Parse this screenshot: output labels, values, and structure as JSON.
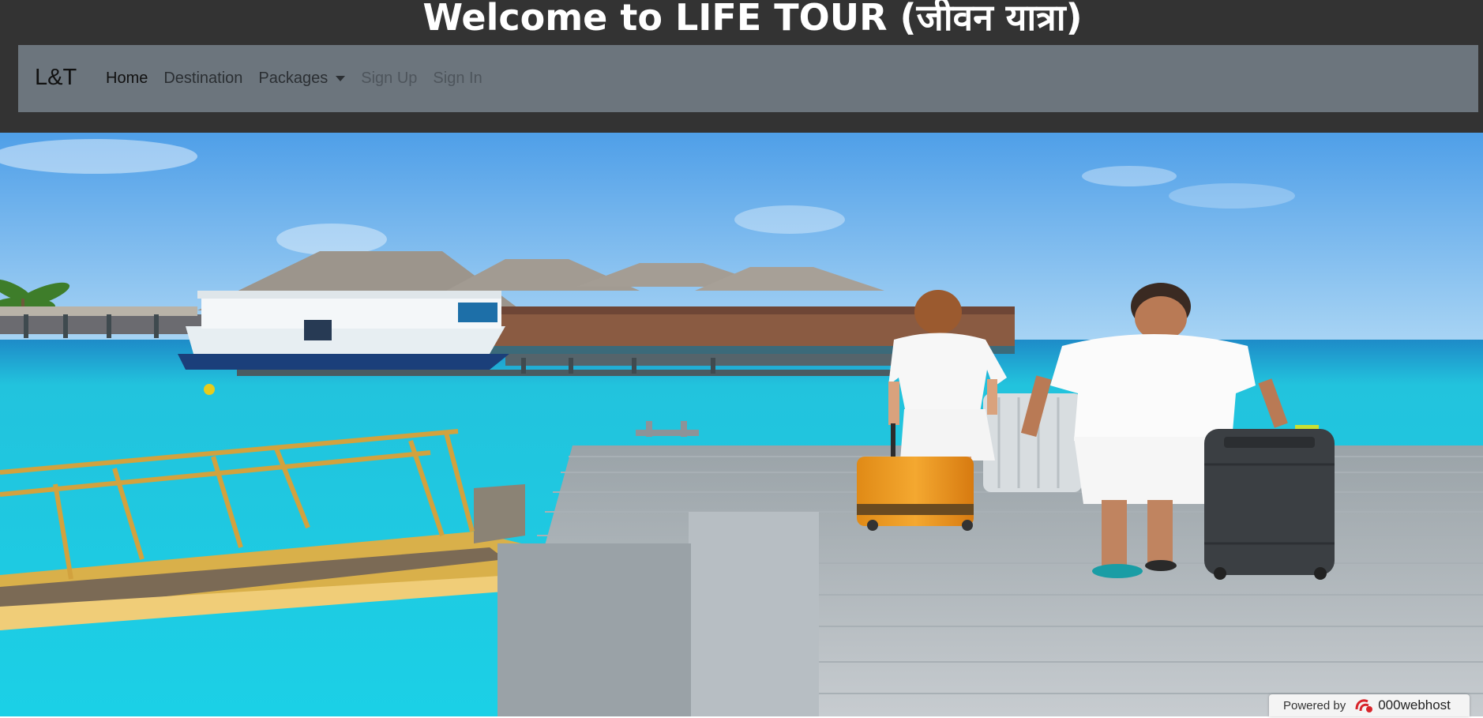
{
  "header": {
    "welcome": "Welcome to LIFE TOUR (जीवन यात्रा)"
  },
  "navbar": {
    "brand": "L&T",
    "items": [
      {
        "label": "Home"
      },
      {
        "label": "Destination"
      },
      {
        "label": "Packages"
      },
      {
        "label": "Sign Up"
      },
      {
        "label": "Sign In"
      }
    ]
  },
  "hero": {
    "icon": "travel-couple-pier-image"
  },
  "badge": {
    "prefix": "Powered by",
    "brand": "000webhost",
    "icon": "000webhost-logo-icon"
  },
  "colors": {
    "header_bg": "#333333",
    "navbar_bg": "#6c757d",
    "sea": "#1fc4dc",
    "sky": "#5aa8ef"
  }
}
